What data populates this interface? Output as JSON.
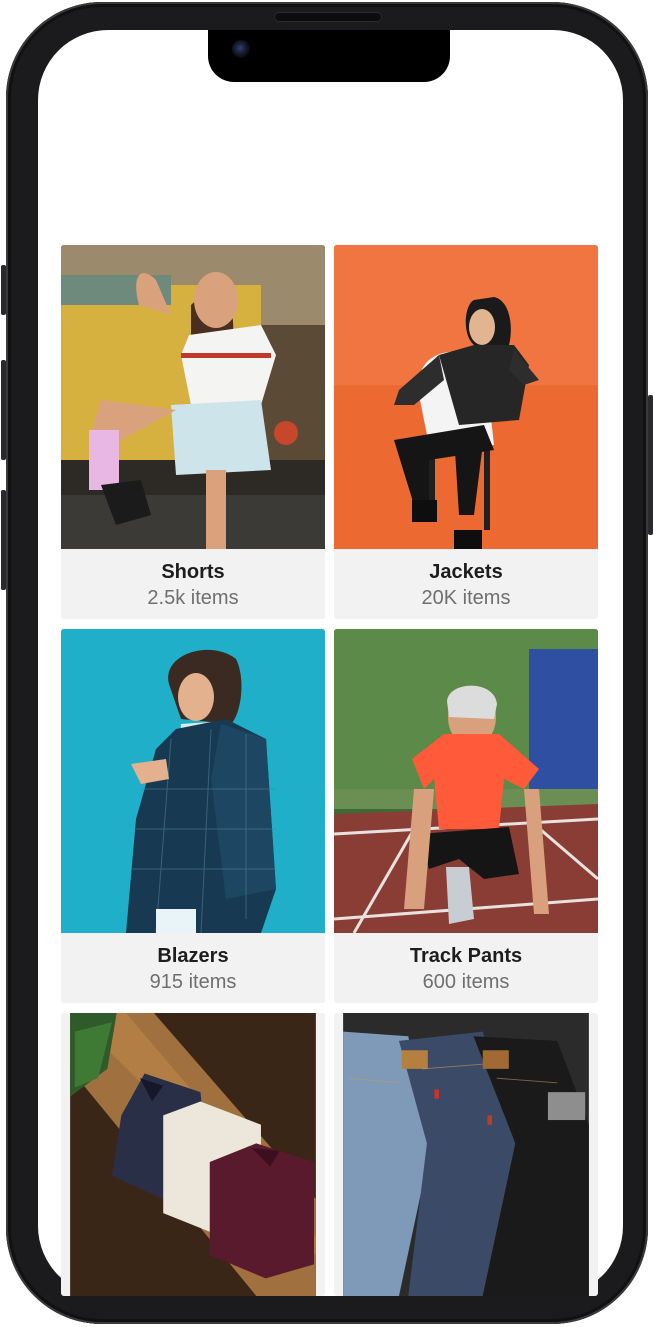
{
  "categories": [
    {
      "title": "Shorts",
      "count": "2.5k items"
    },
    {
      "title": "Jackets",
      "count": "20K items"
    },
    {
      "title": "Blazers",
      "count": "915 items"
    },
    {
      "title": "Track Pants",
      "count": "600 items"
    },
    {
      "title": "",
      "count": ""
    },
    {
      "title": "",
      "count": ""
    }
  ],
  "colors": {
    "frame": "#1b1b1d",
    "caption_bg": "#f2f2f2",
    "title_text": "#1d1d1d",
    "count_text": "#6f6f6f"
  }
}
